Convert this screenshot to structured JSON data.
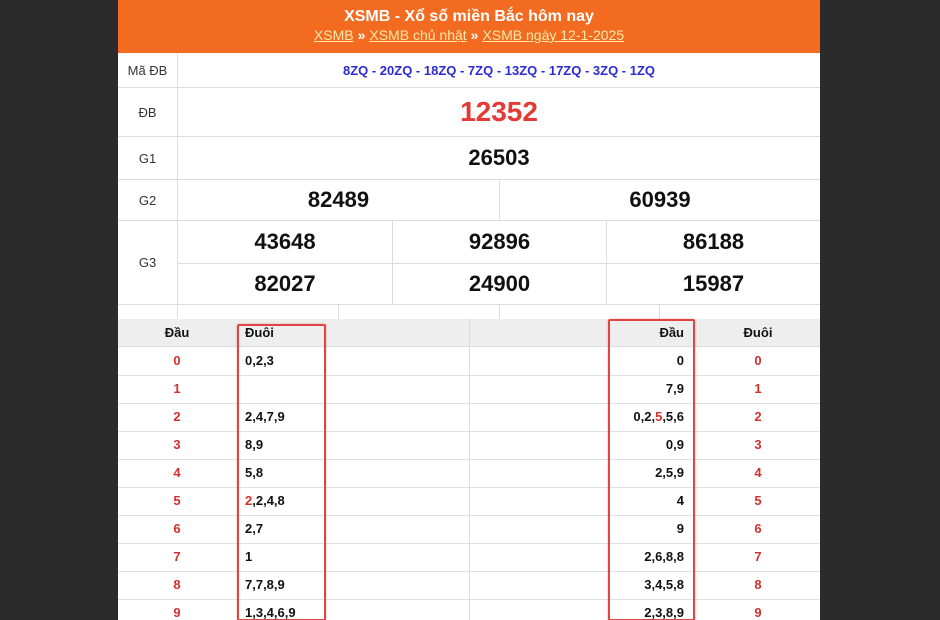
{
  "header": {
    "title": "XSMB - Xổ số miền Bắc hôm nay",
    "breadcrumb": [
      {
        "label": "XSMB"
      },
      {
        "label": "XSMB chủ nhật"
      },
      {
        "label": "XSMB ngày 12-1-2025"
      }
    ],
    "separator": "»"
  },
  "results": {
    "ma_db_label": "Mã ĐB",
    "ma_db_value": "8ZQ - 20ZQ - 18ZQ - 7ZQ - 13ZQ - 17ZQ - 3ZQ - 1ZQ",
    "db_label": "ĐB",
    "db_value": "12352",
    "g1_label": "G1",
    "g1_value": "26503",
    "g2_label": "G2",
    "g2_values": [
      "82489",
      "60939"
    ],
    "g3_label": "G3",
    "g3_values": [
      "43648",
      "92896",
      "86188",
      "82027",
      "24900",
      "15987"
    ]
  },
  "loto": {
    "left_headers": {
      "dau": "Đầu",
      "duoi": "Đuôi"
    },
    "right_headers": {
      "dau": "Đầu",
      "duoi": "Đuôi"
    },
    "left_rows": [
      {
        "dau": "0",
        "duoi": "0,2,3"
      },
      {
        "dau": "1",
        "duoi": ""
      },
      {
        "dau": "2",
        "duoi": "2,4,7,9"
      },
      {
        "dau": "3",
        "duoi": "8,9"
      },
      {
        "dau": "4",
        "duoi": "5,8"
      },
      {
        "dau": "5",
        "duoi_red": "2",
        "duoi": ",2,4,8"
      },
      {
        "dau": "6",
        "duoi": "2,7"
      },
      {
        "dau": "7",
        "duoi": "1"
      },
      {
        "dau": "8",
        "duoi": "7,7,8,9"
      },
      {
        "dau": "9",
        "duoi": "1,3,4,6,9"
      }
    ],
    "right_rows": [
      {
        "values": "0",
        "duoi": "0"
      },
      {
        "values": "7,9",
        "duoi": "1"
      },
      {
        "values_pre": "0,2,",
        "values_red": "5",
        "values_post": ",5,6",
        "duoi": "2"
      },
      {
        "values": "0,9",
        "duoi": "3"
      },
      {
        "values": "2,5,9",
        "duoi": "4"
      },
      {
        "values": "4",
        "duoi": "5"
      },
      {
        "values": "9",
        "duoi": "6"
      },
      {
        "values": "2,6,8,8",
        "duoi": "7"
      },
      {
        "values": "3,4,5,8",
        "duoi": "8"
      },
      {
        "values": "2,3,8,9",
        "duoi": "9"
      }
    ]
  },
  "colors": {
    "header_bg": "#f26b21",
    "breadcrumb_link": "#ffe8a8",
    "db_red": "#e53935",
    "ma_db_blue": "#2b2bd6",
    "highlight_box": "#e04545",
    "page_bg": "#2b2b2b"
  }
}
